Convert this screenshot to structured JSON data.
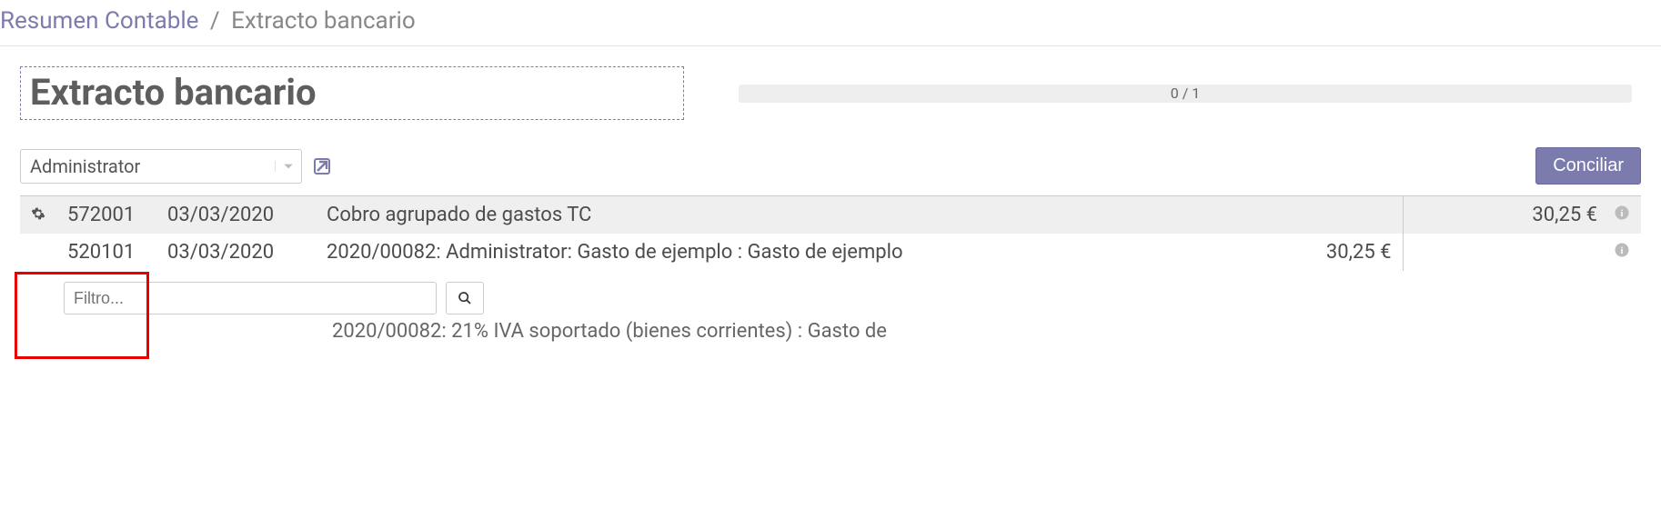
{
  "breadcrumb": {
    "link": "Resumen Contable",
    "separator": "/",
    "current": "Extracto bancario"
  },
  "header": {
    "title": "Extracto bancario",
    "progress": "0 / 1"
  },
  "controls": {
    "partner_value": "Administrator",
    "reconcile_label": "Conciliar"
  },
  "rows": [
    {
      "account": "572001",
      "date": "03/03/2020",
      "description": "Cobro agrupado de gastos TC",
      "amount_left": "",
      "amount_right": "30,25 €"
    },
    {
      "account": "520101",
      "date": "03/03/2020",
      "description": "2020/00082: Administrator: Gasto de ejemplo : Gasto de ejemplo",
      "amount_left": "30,25 €",
      "amount_right": ""
    }
  ],
  "filter": {
    "placeholder": "Filtro..."
  },
  "partial": {
    "account": "",
    "date": "",
    "description": "2020/00082: 21% IVA soportado (bienes corrientes) : Gasto de"
  }
}
